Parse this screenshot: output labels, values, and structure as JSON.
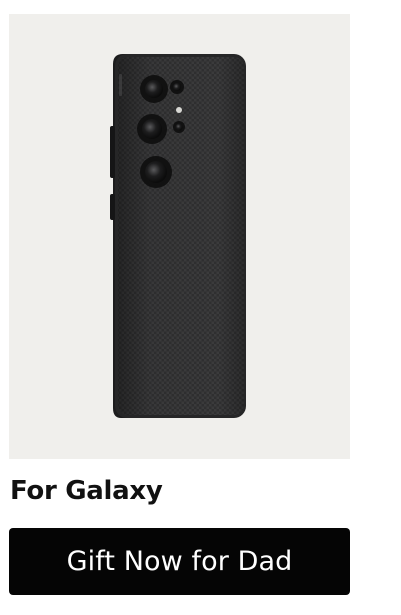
{
  "product": {
    "image_subject": "phone-case-icon",
    "title": "For Galaxy"
  },
  "cta": {
    "label": "Gift Now for Dad"
  },
  "colors": {
    "image_background": "#f0efec",
    "case_body": "#2b2b2b",
    "button_background": "#050505",
    "button_text": "#ffffff",
    "title_text": "#111111"
  }
}
